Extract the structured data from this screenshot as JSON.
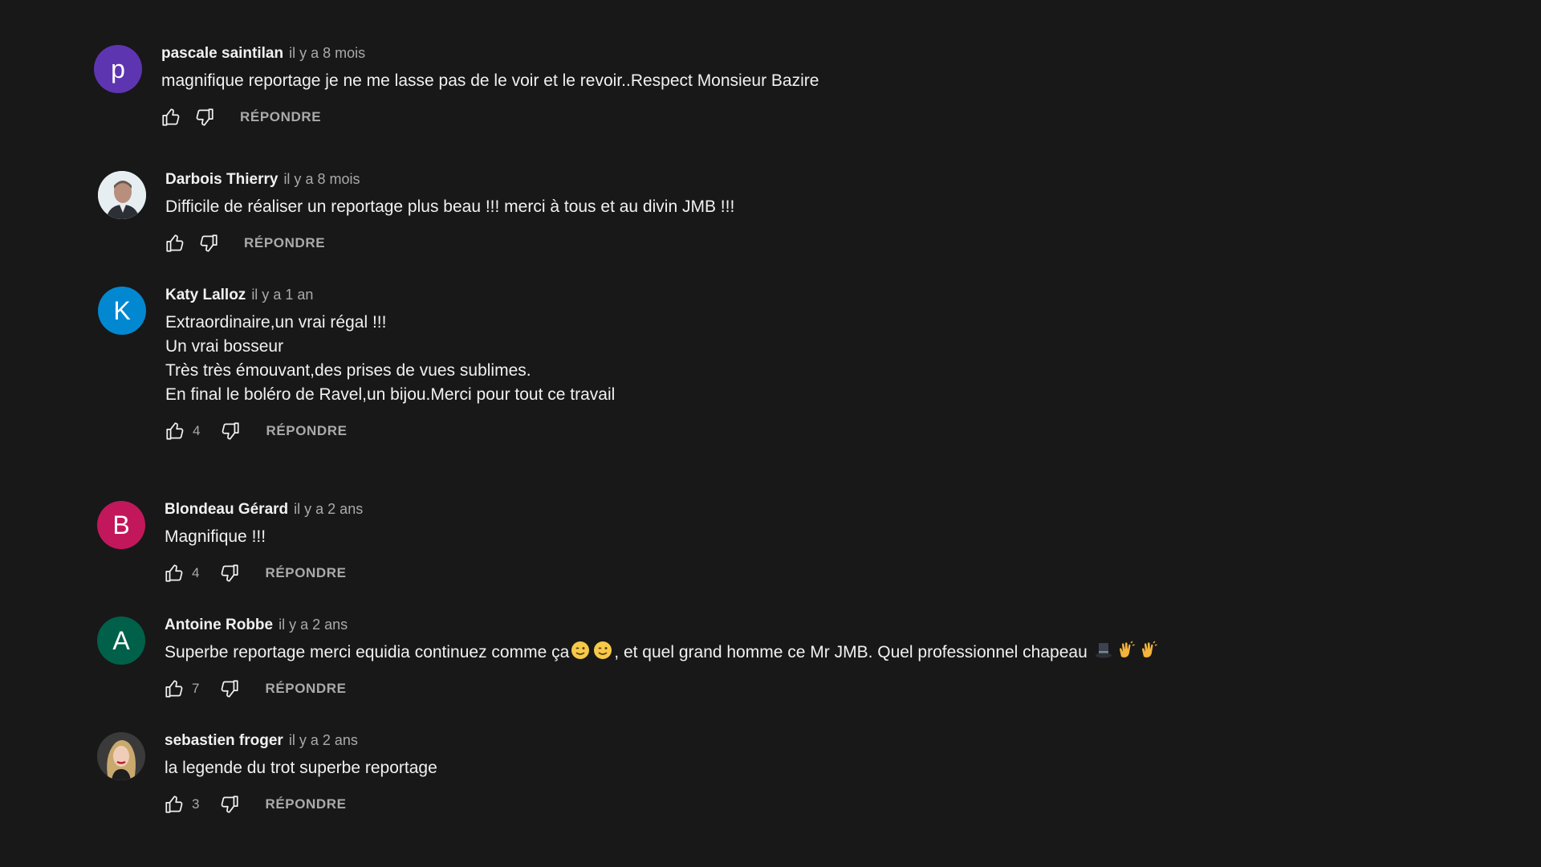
{
  "comments": [
    {
      "author": "pascale saintilan",
      "time": "il y a 8 mois",
      "avatar_letter": "p",
      "avatar_color": "#5e35b1",
      "text": "magnifique reportage je ne me lasse pas de le voir et le revoir..Respect Monsieur Bazire",
      "likes": "",
      "reply_label": "RÉPONDRE"
    },
    {
      "author": "Darbois Thierry",
      "time": "il y a 8 mois",
      "avatar_letter": "",
      "avatar_color": "#dfe6ea",
      "text": "Difficile de réaliser un reportage plus beau !!! merci à tous et au divin JMB !!!",
      "likes": "",
      "reply_label": "RÉPONDRE"
    },
    {
      "author": "Katy Lalloz",
      "time": "il y a 1 an",
      "avatar_letter": "K",
      "avatar_color": "#0288d1",
      "text": "Extraordinaire,un vrai régal !!!\nUn vrai bosseur\nTrès très émouvant,des prises de vues sublimes.\nEn final le boléro de Ravel,un bijou.Merci pour tout ce travail",
      "likes": "4",
      "reply_label": "RÉPONDRE"
    },
    {
      "author": "Blondeau Gérard",
      "time": "il y a 2 ans",
      "avatar_letter": "B",
      "avatar_color": "#c2185b",
      "text": "Magnifique !!!",
      "likes": "4",
      "reply_label": "RÉPONDRE"
    },
    {
      "author": "Antoine Robbe",
      "time": "il y a 2 ans",
      "avatar_letter": "A",
      "avatar_color": "#00604a",
      "text_before": "Superbe reportage merci equidia continuez comme ça",
      "text_middle": ",  et quel grand homme ce Mr JMB. Quel professionnel chapeau",
      "emojis": [
        "wink-emoji",
        "wink-emoji",
        "top-hat-emoji",
        "clapping-hands-emoji",
        "clapping-hands-emoji"
      ],
      "likes": "7",
      "reply_label": "RÉPONDRE"
    },
    {
      "author": "sebastien froger",
      "time": "il y a 2 ans",
      "avatar_letter": "",
      "avatar_color": "#2a2a2a",
      "text": "la legende du trot superbe reportage",
      "likes": "3",
      "reply_label": "RÉPONDRE"
    }
  ],
  "colors": {
    "background": "#181818",
    "text_primary": "#f1f1f1",
    "text_secondary": "#aaaaaa"
  },
  "icons": {
    "like": "thumb-up-icon",
    "dislike": "thumb-down-icon"
  }
}
